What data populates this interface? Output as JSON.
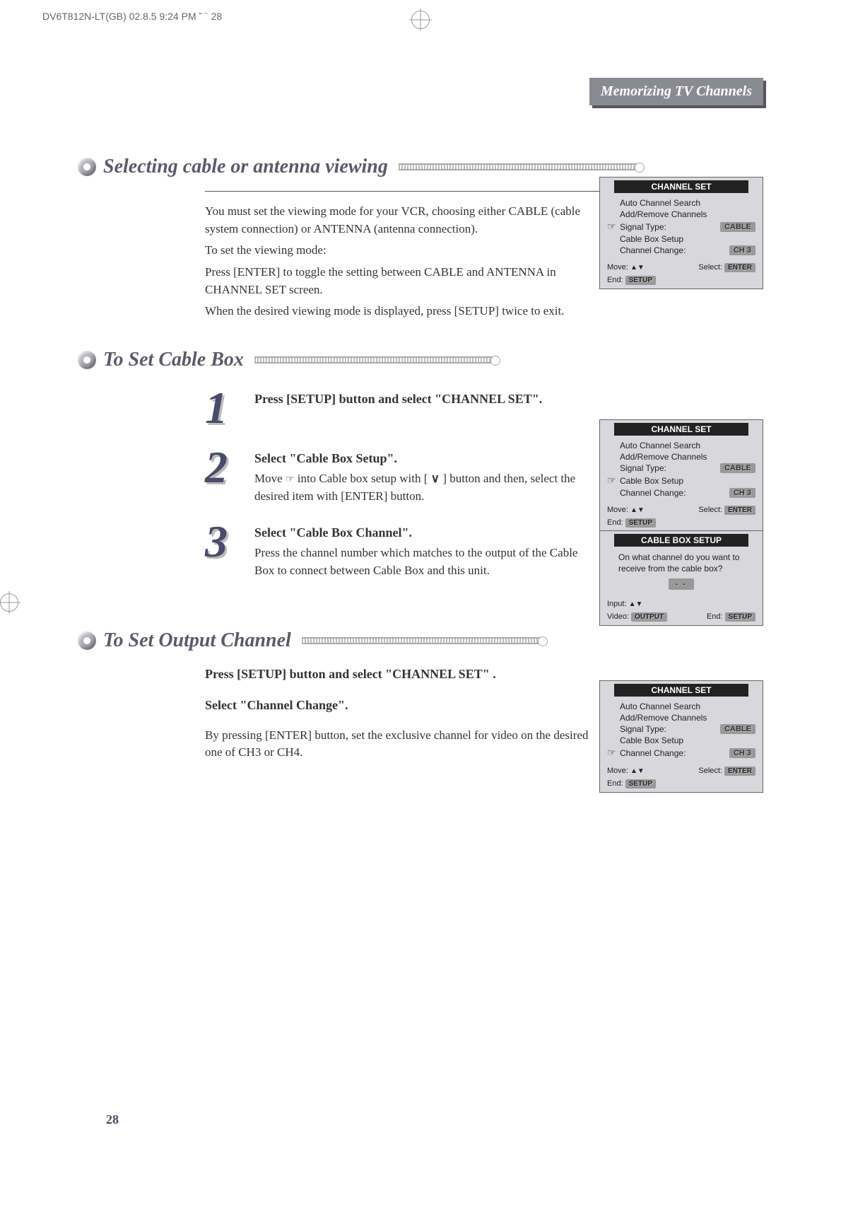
{
  "print_header": "DV6T812N-LT(GB)  02.8.5 9:24 PM  ˘  `  28",
  "header_tag": "Memorizing TV Channels",
  "page_number": "28",
  "section1": {
    "title": "Selecting cable or antenna viewing",
    "p1": "You must set the viewing mode for your VCR, choosing either CABLE (cable system connection) or ANTENNA (antenna connection).",
    "p2": "To set the viewing mode:",
    "p3": "Press [ENTER] to toggle the setting between CABLE and ANTENNA  in CHANNEL SET screen.",
    "p4": "When the desired viewing mode is displayed, press [SETUP] twice to exit."
  },
  "section2": {
    "title": "To Set Cable Box",
    "step1_heading": "Press [SETUP] button and select \"CHANNEL SET\".",
    "step2_heading": "Select \"Cable Box Setup\".",
    "step2_body_a": "Move ",
    "step2_body_b": " into Cable box setup with [ ",
    "step2_body_c": " ] button and then, select the desired item with [ENTER] button.",
    "step3_heading": "Select \"Cable Box Channel\".",
    "step3_body": "Press the channel number which matches to the output of the Cable Box to connect between Cable Box and this unit."
  },
  "section3": {
    "title": "To Set Output Channel",
    "h1": "Press [SETUP] button and select \"CHANNEL SET\" .",
    "h2": "Select \"Channel Change\".",
    "body": "By pressing [ENTER] button, set the exclusive channel for video on the desired one of CH3 or CH4."
  },
  "osd": {
    "channel_set_title": "CHANNEL SET",
    "items": {
      "auto": "Auto Channel Search",
      "addremove": "Add/Remove Channels",
      "signal": "Signal Type:",
      "signal_val": "CABLE",
      "cablebox": "Cable Box Setup",
      "chchange": "Channel Change:",
      "chchange_val": "CH 3"
    },
    "footer": {
      "move": "Move:",
      "select": "Select:",
      "select_val": "ENTER",
      "end": "End:",
      "end_val": "SETUP",
      "input": "Input:",
      "video": "Video:",
      "video_val": "OUTPUT"
    },
    "cablebox_title": "CABLE BOX SETUP",
    "cablebox_q": "On what channel do you want to receive from the cable box?",
    "cablebox_blank": "- -"
  }
}
